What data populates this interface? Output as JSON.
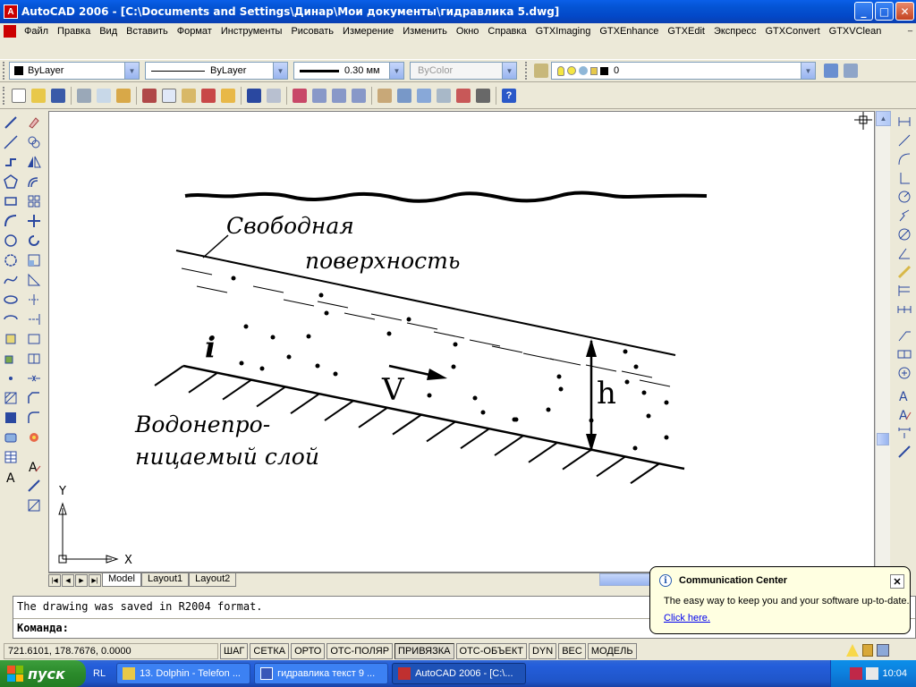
{
  "window": {
    "app_icon": "A",
    "title": "AutoCAD 2006 - [C:\\Documents and Settings\\Динар\\Мои документы\\гидравлика 5.dwg]",
    "buttons": {
      "minimize": "_",
      "maximize": "□",
      "close": "✕"
    }
  },
  "menu": {
    "items": [
      "Файл",
      "Правка",
      "Вид",
      "Вставить",
      "Формат",
      "Инструменты",
      "Рисовать",
      "Измерение",
      "Изменить",
      "Окно",
      "Справка",
      "GTXImaging",
      "GTXEnhance",
      "GTXEdit",
      "Экспресс",
      "GTXConvert",
      "GTXVClean"
    ],
    "mdi": {
      "minimize": "_",
      "restore": "⧉",
      "close": "✕"
    }
  },
  "properties": {
    "color": "ByLayer",
    "linetype": "ByLayer",
    "lineweight": "0.30 мм",
    "plotstyle": "ByColor",
    "layer": "0"
  },
  "drawing": {
    "labels": {
      "free_surface_1": "Свободная",
      "free_surface_2": "поверхность",
      "slope": "i",
      "velocity": "V",
      "depth": "h",
      "layer_1": "Водонепро-",
      "layer_2": "ницаемый слой"
    },
    "ucs": {
      "y": "Y",
      "x": "X"
    }
  },
  "tabs": {
    "items": [
      "Model",
      "Layout1",
      "Layout2"
    ],
    "active": "Model"
  },
  "command": {
    "history": "The drawing was saved in R2004 format.",
    "prompt": "Команда:"
  },
  "status": {
    "coords": "721.6101, 178.7676, 0.0000",
    "toggles": [
      {
        "label": "ШАГ",
        "on": false
      },
      {
        "label": "СЕТКА",
        "on": false
      },
      {
        "label": "ОРТО",
        "on": false
      },
      {
        "label": "ОТС-ПОЛЯР",
        "on": false
      },
      {
        "label": "ПРИВЯЗКА",
        "on": true
      },
      {
        "label": "ОТС-ОБЪЕКТ",
        "on": false
      },
      {
        "label": "DYN",
        "on": false
      },
      {
        "label": "ВЕС",
        "on": false
      },
      {
        "label": "МОДЕЛЬ",
        "on": false
      }
    ]
  },
  "balloon": {
    "title": "Communication Center",
    "text": "The easy way to keep you and your software up-to-date.",
    "link": "Click here."
  },
  "taskbar": {
    "start": "пуск",
    "quicklaunch": "RL",
    "tasks": [
      {
        "label": "13. Dolphin - Telefon ...",
        "active": false
      },
      {
        "label": "гидравлика текст 9 ...",
        "active": false
      },
      {
        "label": "AutoCAD 2006 - [C:\\...",
        "active": true
      }
    ],
    "clock": "10:04"
  },
  "colors": {
    "titlebar": "#0454d4",
    "taskbar": "#245edb",
    "start": "#2b8a2b",
    "balloon_bg": "#ffffe1"
  }
}
